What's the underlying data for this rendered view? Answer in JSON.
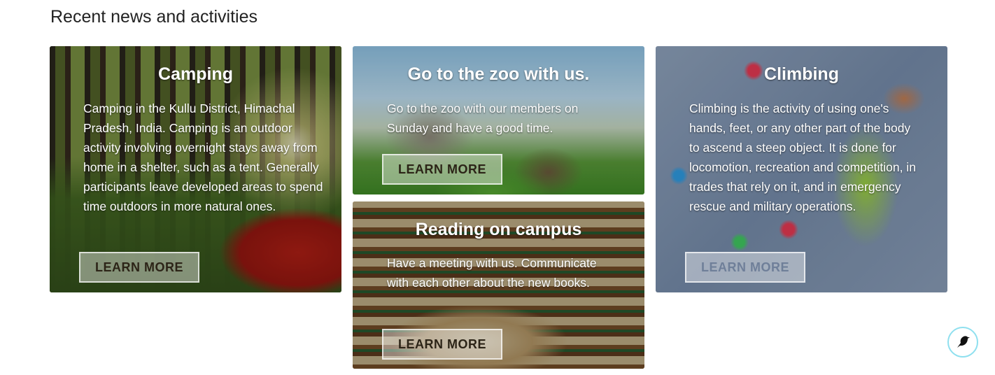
{
  "section": {
    "title": "Recent news and activities"
  },
  "cards": [
    {
      "title": "Camping",
      "text": "Camping in the Kullu District, Himachal Pradesh, India. Camping is an outdoor activity involving overnight stays away from home in a shelter, such as a tent. Generally participants leave developed areas to spend time outdoors in more natural ones.",
      "button": "LEARN MORE"
    },
    {
      "title": "Go to the zoo with us.",
      "text": "Go to the zoo with our members on Sunday and have a good time.",
      "button": "LEARN MORE"
    },
    {
      "title": "Reading on campus",
      "text": "Have a meeting with us. Communicate with each other about the new books.",
      "button": "LEARN MORE"
    },
    {
      "title": "Climbing",
      "text": "Climbing is the activity of using one's hands, feet, or any other part of the body to ascend a steep object. It is done for locomotion, recreation and competition, in trades that rely on it, and in emergency rescue and military operations.",
      "button": "LEARN MORE"
    }
  ],
  "floating_button": {
    "icon": "bird-icon"
  }
}
